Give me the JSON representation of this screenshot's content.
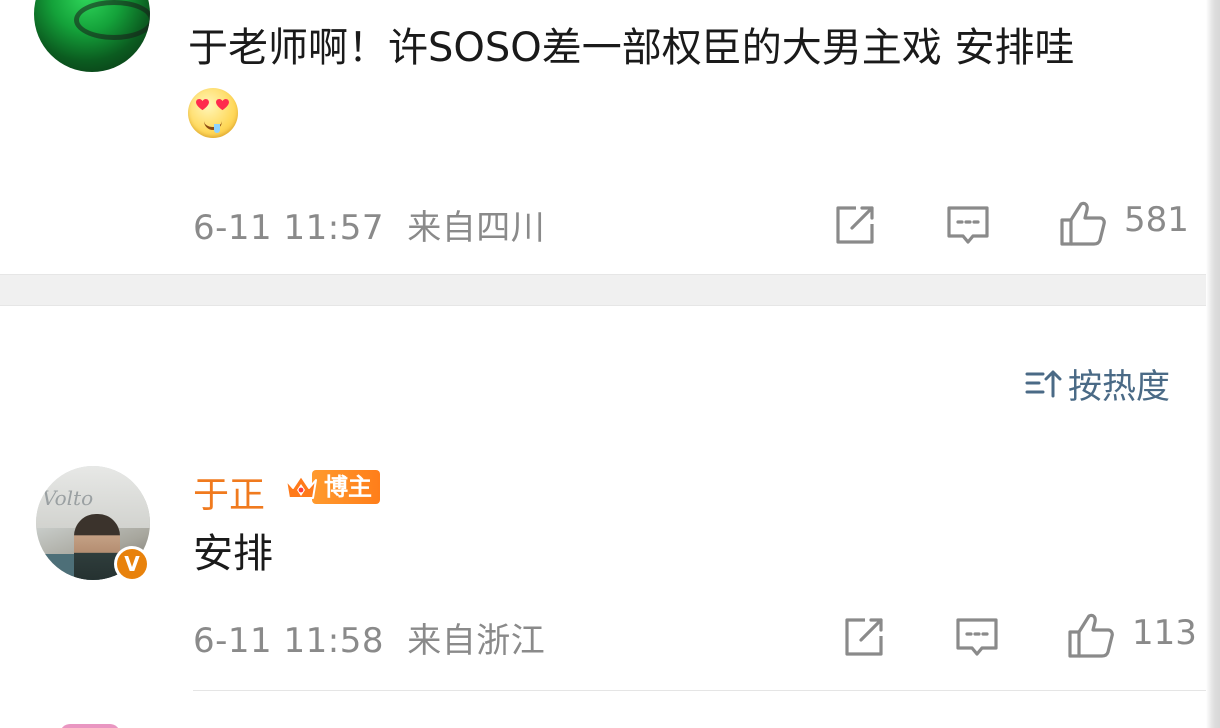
{
  "comments": [
    {
      "text": "于老师啊！许SOSO差一部权臣的大男主戏 安排哇",
      "emoji": "heart-eyes-drool-emoji",
      "time": "6-11 11:57",
      "location": "来自四川",
      "likes": "581"
    },
    {
      "username": "于正",
      "badge": "博主",
      "verified_label": "V",
      "text": "安排",
      "time": "6-11 11:58",
      "location": "来自浙江",
      "likes": "113"
    }
  ],
  "sort": {
    "label": "按热度"
  },
  "colors": {
    "username": "#f07a1e",
    "sort_text": "#4a6a86",
    "meta_text": "#8a8a8a",
    "badge_bg": "#ff8a22",
    "verified_bg": "#e8820c"
  },
  "icons": {
    "share": "share-icon",
    "comment": "comment-icon",
    "like": "thumbs-up-icon",
    "sort": "sort-icon"
  }
}
